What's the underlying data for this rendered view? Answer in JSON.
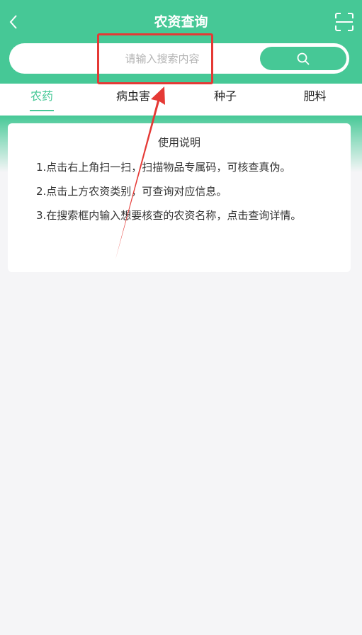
{
  "header": {
    "title": "农资查询",
    "back_icon": "chevron-left-icon",
    "scan_icon": "scan-icon",
    "background_color": "#46c896"
  },
  "search": {
    "placeholder": "请输入搜索内容",
    "value": "",
    "button_icon": "search-icon"
  },
  "tabs": [
    {
      "label": "农药",
      "active": true
    },
    {
      "label": "病虫害",
      "active": false
    },
    {
      "label": "种子",
      "active": false
    },
    {
      "label": "肥料",
      "active": false
    }
  ],
  "instructions": {
    "title": "使用说明",
    "items": [
      "1.点击右上角扫一扫，扫描物品专属码，可核查真伪。",
      "2.点击上方农资类别，可查询对应信息。",
      "3.在搜索框内输入想要核查的农资名称，点击查询详情。"
    ]
  },
  "colors": {
    "accent": "#46c896",
    "annotation": "#e53935"
  }
}
